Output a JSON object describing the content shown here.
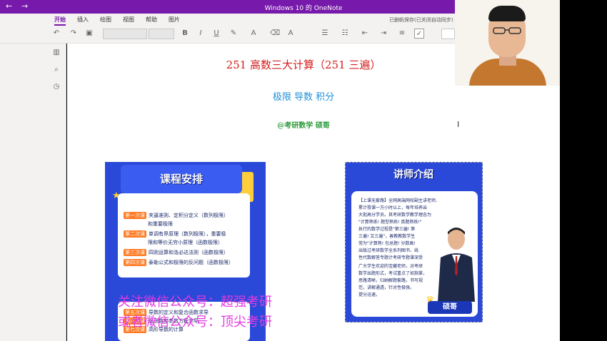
{
  "window": {
    "title": "Windows 10 的 OneNote",
    "right_text": "H",
    "back_icon": "←",
    "forward_icon": "→"
  },
  "ribbon": {
    "tabs": [
      "开始",
      "插入",
      "绘图",
      "视图",
      "帮助",
      "图片"
    ],
    "active_tab": "开始",
    "save_status": "已删帆保存(已关闭自动同步)"
  },
  "colors": {
    "accent": "#7719aa",
    "title_red": "#d51d1d",
    "subtitle_blue": "#1f8fd6",
    "author_green": "#2e9b3b",
    "watermark": "#e23be0",
    "poster_blue": "#2a49d8"
  },
  "page": {
    "title": "251 高数三大计算（251 三遍）",
    "subtitle": "极限  导数  积分",
    "author": "@考研数学 硕哥"
  },
  "poster1": {
    "banner": "课程安排",
    "lessons": [
      {
        "label": "第一次课",
        "text": "夹逼准则、定积分定义（数列极限）"
      },
      {
        "label": "",
        "text": "和重要极限"
      },
      {
        "label": "第二次课",
        "text": "单调有界原理（数列极限），重要极"
      },
      {
        "label": "",
        "text": "限和等价无穷小原理（函数极限）"
      },
      {
        "label": "第三次课",
        "text": "四则运算和洛必达法则（函数极限）"
      },
      {
        "label": "第四次课",
        "text": "泰勒公式和极限的反问题（函数极限）"
      }
    ],
    "lessons_lower": [
      {
        "label": "第五次课",
        "text": "导数的定义和复合函数求导"
      },
      {
        "label": "第六次课",
        "text": "隐函数和参数方程求导"
      },
      {
        "label": "第七次课",
        "text": "高阶导数的计算"
      }
    ]
  },
  "poster2": {
    "banner": "讲师介绍",
    "bio": [
      "【上课无套路】全网高端网校副主讲老师,",
      "累计授课一万小时以上，每年培养出",
      "大批高分学员。其考研数学教学理念为",
      "\"计算熟练! 题型熟练! 真题熟练!\"",
      "执行的数学过程是\"第三遍! 第",
      "三遍! 又三遍\"，善教教数学生",
      "常为\"计算熟! 包总题! 分数高!",
      "出版过考研数学全系列图书，线",
      "性代数解答专题计考研专题课深受",
      "广大学生欢迎的宝藏老师，对考研",
      "数学出题形式，考试重点了如指掌，",
      "思路清晰，归纳解题套路，书写规",
      "范，讲解通透，针对性极强，",
      "提分迅速。"
    ],
    "name": "硕哥"
  },
  "watermark": {
    "line1": "关注微信公众号：超强考研",
    "line2": "或者微信公众号：顶尖考研"
  },
  "icons": [
    "undo-icon",
    "redo-icon",
    "clipboard-icon",
    "bold-icon",
    "italic-icon",
    "underline-icon",
    "highlight-icon",
    "font-color-icon",
    "eraser-icon",
    "style-icon",
    "bullets-icon",
    "numbering-icon",
    "outdent-icon",
    "indent-icon",
    "align-icon",
    "checkbox-icon",
    "notebooks-icon",
    "search-icon",
    "recent-icon",
    "text-cursor-icon"
  ]
}
